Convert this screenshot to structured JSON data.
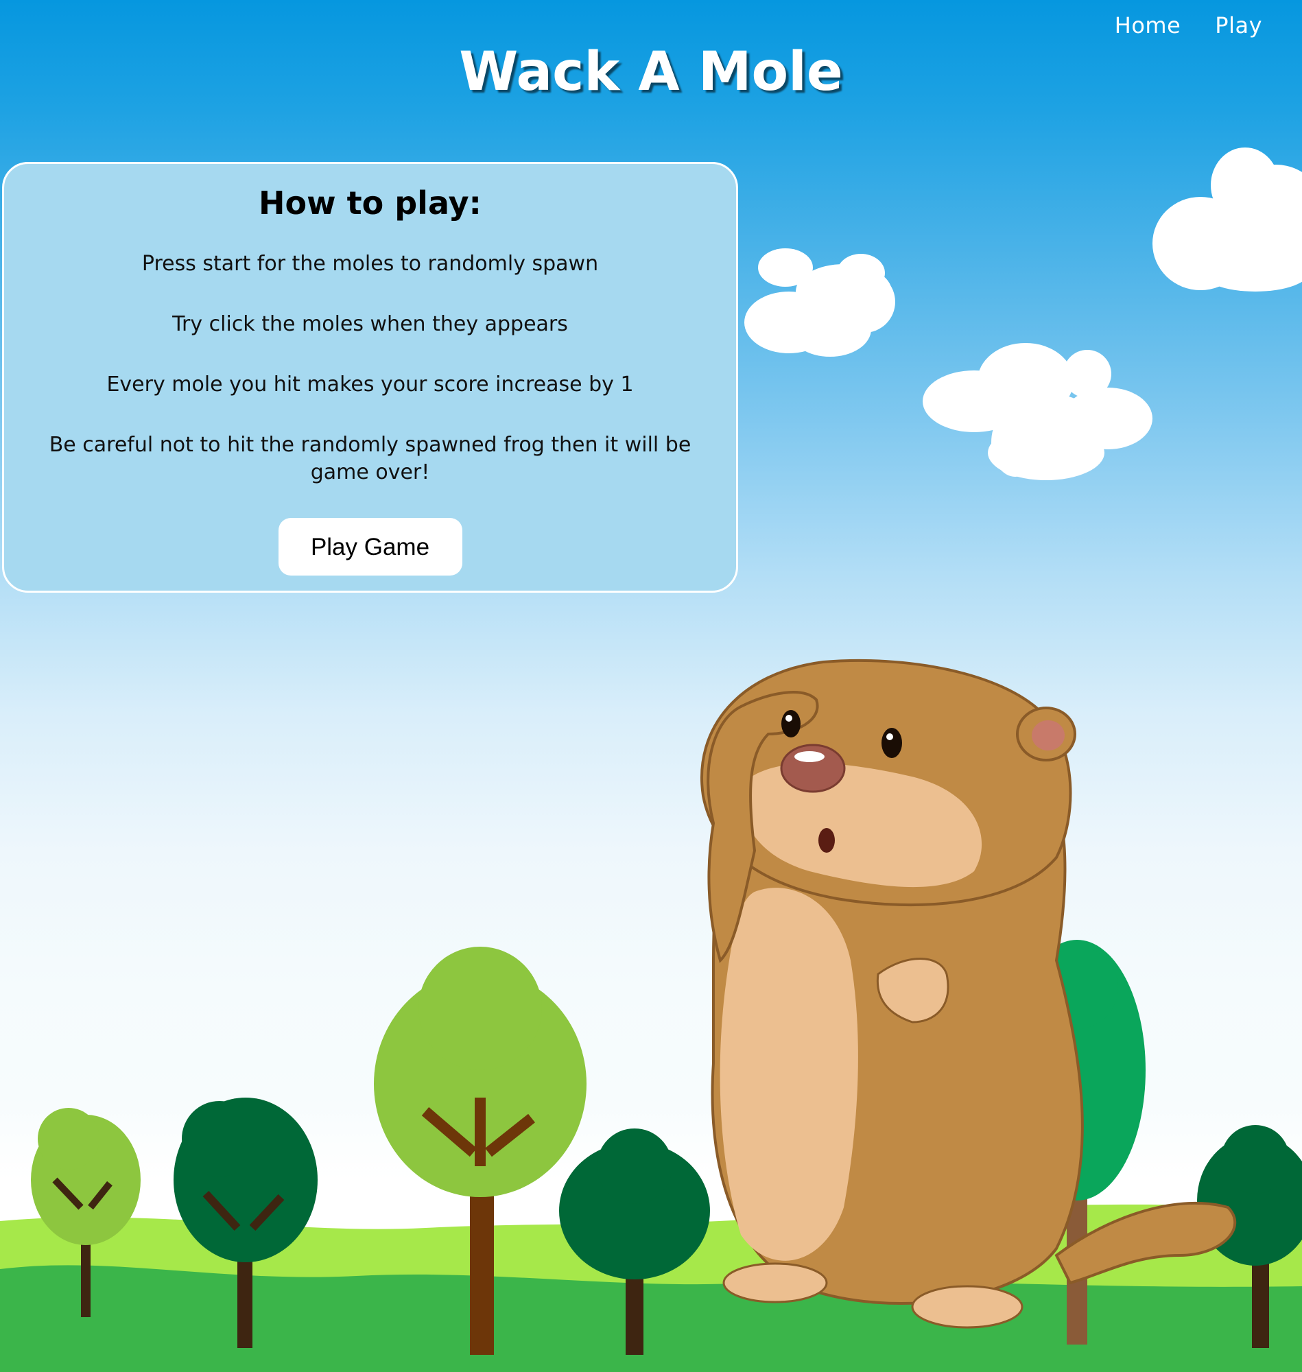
{
  "nav": {
    "home": "Home",
    "play": "Play"
  },
  "title": "Wack A Mole",
  "instructions": {
    "heading": "How to play:",
    "rules": [
      "Press start for the moles to randomly spawn",
      "Try click the moles when they appears",
      "Every mole you hit makes your score increase by 1",
      "Be careful not to hit the randomly spawned frog then it will be game over!"
    ],
    "button_label": "Play Game"
  },
  "colors": {
    "sky_top": "#0697df",
    "panel_bg": "#a6d9f0",
    "grass": "#3bb54a",
    "mole_body": "#c08a45",
    "mole_belly": "#ecbf90"
  },
  "illustration": {
    "character": "mole-illustration",
    "scenery": [
      "cloud",
      "cloud",
      "cloud",
      "tree",
      "tree",
      "tree",
      "tree",
      "tree",
      "tree",
      "grass-hills"
    ]
  }
}
